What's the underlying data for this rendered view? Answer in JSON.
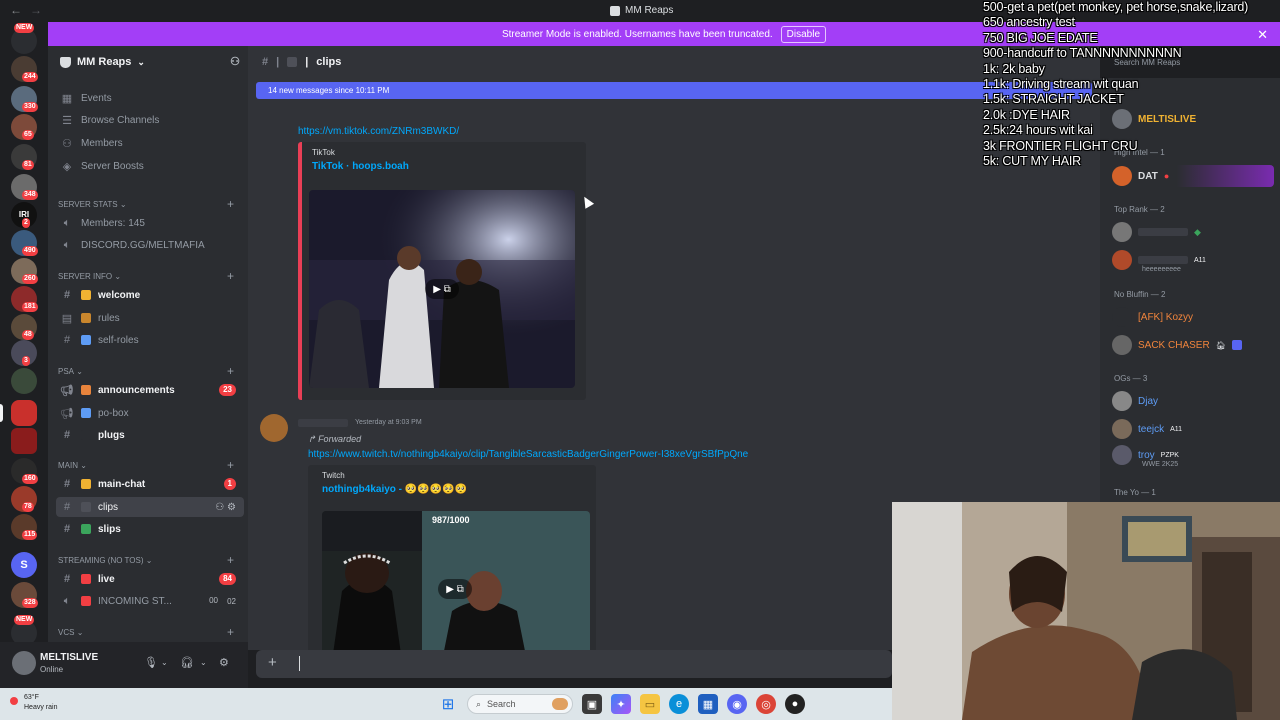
{
  "window": {
    "title": "MM Reaps"
  },
  "banner": {
    "text": "Streamer Mode is enabled. Usernames have been truncated.",
    "button": "Disable"
  },
  "server_list": {
    "badges": [
      "NEW",
      "244",
      "330",
      "65",
      "81",
      "348",
      "2",
      "490",
      "260",
      "181",
      "48",
      "3",
      "160",
      "78",
      "115",
      "328",
      "NEW"
    ]
  },
  "server": {
    "name": "MM Reaps",
    "top_items": [
      {
        "icon": "calendar-icon",
        "label": "Events"
      },
      {
        "icon": "browse-icon",
        "label": "Browse Channels"
      },
      {
        "icon": "members-icon",
        "label": "Members"
      },
      {
        "icon": "boost-icon",
        "label": "Server Boosts"
      }
    ],
    "categories": {
      "server_stats": "SERVER STATS",
      "server_info": "SERVER INFO",
      "psa": "PSA",
      "main": "MAIN",
      "streaming": "STREAMING (NO TOS)",
      "vcs": "VCs"
    },
    "stats_channels": [
      "Members: 145",
      "DISCORD.GG/MELTMAFIA"
    ],
    "info_channels": [
      "welcome",
      "rules",
      "self-roles"
    ],
    "psa_channels": [
      {
        "name": "announcements",
        "count": "23"
      },
      {
        "name": "po-box"
      },
      {
        "name": "plugs"
      }
    ],
    "main_channels": [
      {
        "name": "main-chat",
        "count": "1"
      },
      {
        "name": "clips"
      },
      {
        "name": "slips"
      }
    ],
    "streaming_channels": [
      {
        "name": "live",
        "count": "84"
      },
      {
        "name": "INCOMING ST...",
        "count_a": "00",
        "count_b": "02"
      }
    ]
  },
  "user": {
    "name": "MELTISLIVE",
    "status": "Online"
  },
  "chat": {
    "channel": "clips",
    "new_messages": "14 new messages since 10:11 PM",
    "msg1": {
      "link": "https://vm.tiktok.com/ZNRm3BWKD/",
      "provider": "TikTok",
      "title": "TikTok · hoops.boah"
    },
    "msg2": {
      "timestamp": "Yesterday at 9:03 PM",
      "forwarded": "Forwarded",
      "link": "https://www.twitch.tv/nothingb4kaiyo/clip/TangibleSarcasticBadgerGingerPower-I38xeVgrSBfPpQne",
      "provider": "Twitch",
      "title": "nothingb4kaiyo - 🥺🥺🥺🥺🥺",
      "video_counter": "987/1000"
    }
  },
  "members": {
    "search_placeholder": "Search MM Reaps",
    "groups": [
      {
        "label": "High Intel — 1",
        "members": [
          {
            "name": "DAT",
            "color": "#f2f3f5"
          }
        ]
      },
      {
        "label": "Top Rank — 2",
        "members": []
      },
      {
        "label": "No Bluffin — 2",
        "members": [
          {
            "name": "[AFK] Kozyy",
            "color": "#f0843c"
          },
          {
            "name": "SACK CHASER",
            "color": "#f0843c"
          }
        ]
      },
      {
        "label": "OGs — 3",
        "members": [
          {
            "name": "Djay",
            "color": "#5e9cf5"
          },
          {
            "name": "teejck",
            "color": "#5e9cf5"
          },
          {
            "name": "troy",
            "color": "#5e9cf5"
          }
        ]
      },
      {
        "label": "The Yo — 1",
        "members": []
      }
    ],
    "top_member": "MELTISLIVE",
    "kdk_status": "heeeeeeeee",
    "troy_sub": "WWE 2K25",
    "a11_tag": "A11",
    "pzpk_tag": "PZPK"
  },
  "overlay": {
    "lines": [
      "500-get a pet(pet monkey, pet horse,snake,lizard)",
      "650 ancestry test",
      "750 BIG JOE EDATE",
      "900-handcuff to TANNNNNNNNNNN",
      "1k: 2k baby",
      "1.1k: Driving stream wit quan",
      "1.5k: STRAIGHT JACKET",
      "2.0k :DYE HAIR",
      "2.5k:24 hours wit kai",
      "3k FRONTIER FLIGHT CRU",
      "5k: CUT MY HAIR"
    ]
  },
  "taskbar": {
    "temp": "63°F",
    "weather": "Heavy rain",
    "search": "Search"
  },
  "colors": {
    "banner": "#a33ef7",
    "accent": "#5865f2",
    "link": "#00a8fc",
    "embed_bar": "#e93f56"
  }
}
